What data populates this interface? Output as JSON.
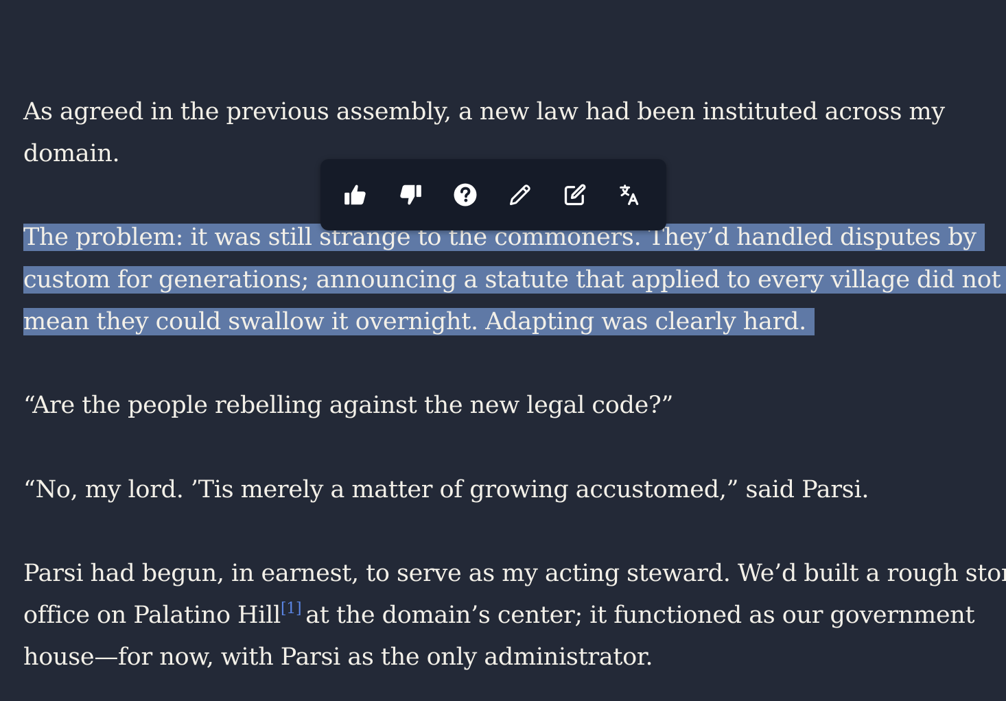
{
  "story": {
    "paragraph1": {
      "line1": "As agreed in the previous assembly, a new law had been instituted across my",
      "line2": "domain."
    },
    "selected_paragraph": {
      "line1": "The problem: it was still strange to the commoners. They’d handled disputes by",
      "line2": "custom for generations; announcing a statute that applied to every village did not",
      "line3": "mean they could swallow it overnight. Adapting was clearly hard."
    },
    "quote1": "“Are the people rebelling against the new legal code?”",
    "quote2": "“No, my lord. ’Tis merely a matter of growing accustomed,” said Parsi.",
    "paragraph4": {
      "line1": "Parsi had begun, in earnest, to serve as my acting steward. We’d built a rough stone",
      "line2_before": "office on Palatino Hill",
      "footnote": "[1]",
      "line2_after": "at the domain’s center; it functioned as our government",
      "line3": "house—for now, with Parsi as the only administrator."
    }
  },
  "toolbar": {
    "buttons": [
      {
        "icon": "thumbs-up-icon"
      },
      {
        "icon": "thumbs-down-icon"
      },
      {
        "icon": "question-circle-icon"
      },
      {
        "icon": "pencil-icon"
      },
      {
        "icon": "edit-square-icon"
      },
      {
        "icon": "translate-icon"
      }
    ]
  },
  "colors": {
    "background": "#232937",
    "text": "#f3f0e8",
    "selection": "#5f79a6",
    "toolbar": "#151b28",
    "footnote": "#5b86e5"
  }
}
